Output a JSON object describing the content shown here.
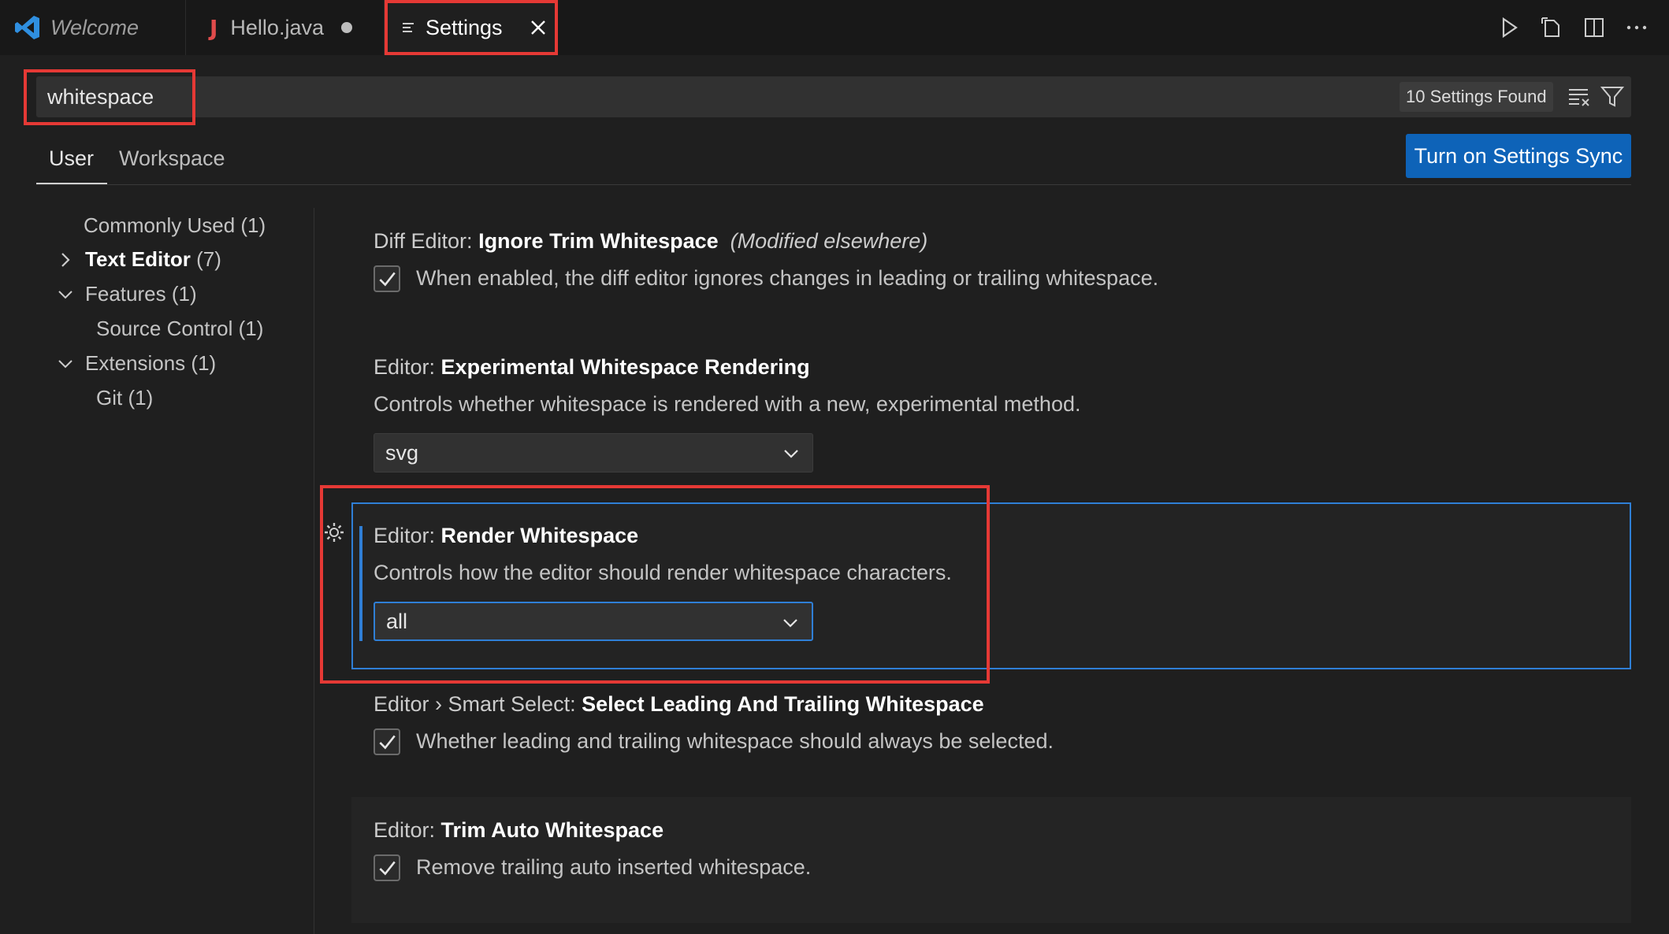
{
  "tabs": {
    "welcome": "Welcome",
    "hello": "Hello.java",
    "hello_icon": "J",
    "settings": "Settings"
  },
  "search": {
    "value": "whitespace",
    "found": "10 Settings Found"
  },
  "scopes": {
    "user": "User",
    "workspace": "Workspace",
    "sync_button": "Turn on Settings Sync"
  },
  "toc": [
    "Commonly Used (1)",
    "Text Editor",
    "(7)",
    "Features (1)",
    "Source Control (1)",
    "Extensions (1)",
    "Git (1)"
  ],
  "settings": [
    {
      "category": "Diff Editor: ",
      "name": "Ignore Trim Whitespace",
      "note": "(Modified elsewhere)",
      "description": "When enabled, the diff editor ignores changes in leading or trailing whitespace."
    },
    {
      "category": "Editor: ",
      "name": "Experimental Whitespace Rendering",
      "description": "Controls whether whitespace is rendered with a new, experimental method.",
      "value": "svg"
    },
    {
      "category": "Editor: ",
      "name": "Render Whitespace",
      "description": "Controls how the editor should render whitespace characters.",
      "value": "all"
    },
    {
      "category": "Editor › Smart Select: ",
      "name": "Select Leading And Trailing Whitespace",
      "description": "Whether leading and trailing whitespace should always be selected."
    },
    {
      "category": "Editor: ",
      "name": "Trim Auto Whitespace",
      "description": "Remove trailing auto inserted whitespace."
    }
  ],
  "colors": {
    "accent": "#2f7fd6",
    "button": "#0e63b8",
    "annotation": "#e53935"
  },
  "icons": [
    "vscode-logo-icon",
    "java-icon",
    "dirty-dot-icon",
    "settings-file-icon",
    "close-icon",
    "run-icon",
    "open-changes-icon",
    "split-editor-icon",
    "more-actions-icon",
    "clear-filter-icon",
    "filter-icon",
    "chevron-right-icon",
    "chevron-down-icon",
    "checkmark-icon",
    "gear-icon"
  ]
}
